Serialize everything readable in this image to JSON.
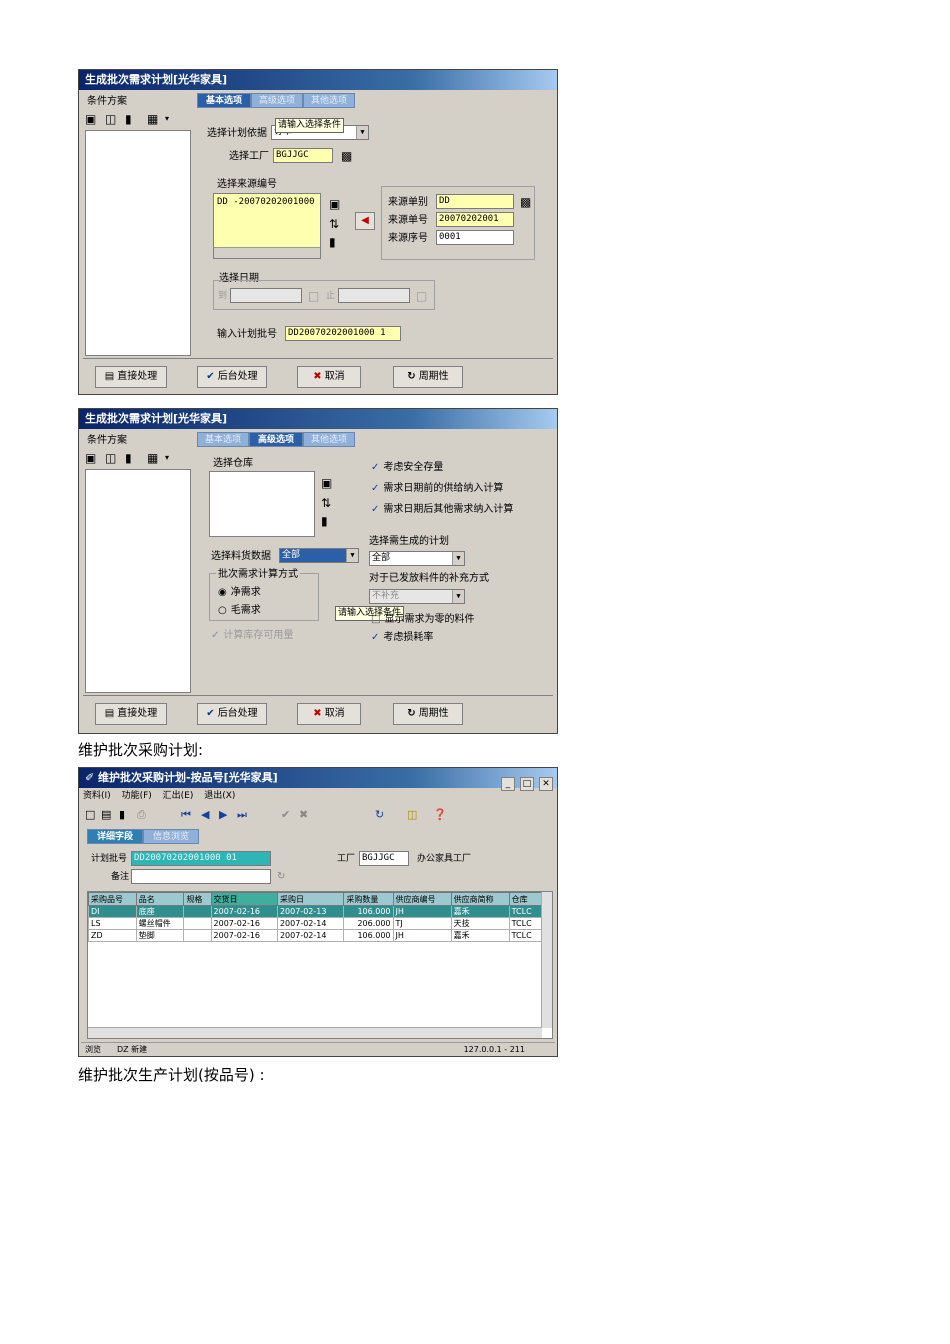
{
  "win1": {
    "title": "生成批次需求计划[光华家具]",
    "scheme_label": "条件方案",
    "tabs": [
      "基本选项",
      "高级选项",
      "其他选项"
    ],
    "plan_name_label": "选择计划依据",
    "plan_name_value": "订单",
    "tooltip": "请输入选择条件",
    "factory_label": "选择工厂",
    "factory_value": "BGJJGC",
    "source_no_label": "选择来源编号",
    "source_list_item": "DD  -20070202001000",
    "source_type_label": "来源单别",
    "source_type_value": "DD",
    "source_no2_label": "来源单号",
    "source_no2_value": "20070202001",
    "source_seq_label": "来源序号",
    "source_seq_value": "0001",
    "date_label": "选择日期",
    "date_from": "到",
    "date_to": "止",
    "batch_label": "输入计划批号",
    "batch_value": "DD20070202001000 1",
    "buttons": [
      "直接处理",
      "后台处理",
      "取消",
      "周期性"
    ]
  },
  "win2": {
    "title": "生成批次需求计划[光华家具]",
    "scheme_label": "条件方案",
    "tabs": [
      "基本选项",
      "高级选项",
      "其他选项"
    ],
    "warehouse_label": "选择仓库",
    "check1": "考虑安全存量",
    "check2": "需求日期前的供给纳入计算",
    "check3": "需求日期后其他需求纳入计算",
    "gen_plan_label": "选择需生成的计划",
    "gen_plan_value": "全部",
    "material_label": "选择料货数据",
    "material_value": "全部",
    "method_label": "批次需求计算方式",
    "radio1": "净需求",
    "radio2": "毛需求",
    "supplement_label": "对于已发放料件的补充方式",
    "supplement_value": "不补充",
    "tooltip": "请输入选择条件",
    "check4": "显示需求为零的料件",
    "check5": "考虑损耗率",
    "check6": "计算库存可用量",
    "buttons": [
      "直接处理",
      "后台处理",
      "取消",
      "周期性"
    ]
  },
  "caption1": "维护批次采购计划:",
  "win3": {
    "title": "维护批次采购计划-按品号[光华家具]",
    "menu": [
      "资料(I)",
      "功能(F)",
      "汇出(E)",
      "退出(X)"
    ],
    "tabs": [
      "详细字段",
      "信息浏览"
    ],
    "batch_label": "计划批号",
    "batch_value": "DD20070202001000 01",
    "remark_label": "备注",
    "factory_label": "工厂",
    "factory_value": "BGJJGC",
    "factory_name": "办公家具工厂",
    "columns": [
      "采购品号",
      "品名",
      "规格",
      "交货日",
      "采购日",
      "采购数量",
      "供应商编号",
      "供应商简称",
      "仓库"
    ],
    "rows": [
      [
        "DI",
        "底座",
        "",
        "2007-02-16",
        "2007-02-13",
        "106.000",
        "JH",
        "嘉禾",
        "TCLC"
      ],
      [
        "LS",
        "螺丝帽件",
        "",
        "2007-02-16",
        "2007-02-14",
        "206.000",
        "TJ",
        "天技",
        "TCLC"
      ],
      [
        "ZD",
        "垫脚",
        "",
        "2007-02-16",
        "2007-02-14",
        "106.000",
        "JH",
        "嘉禾",
        "TCLC"
      ]
    ],
    "status": [
      "浏览",
      "DZ 新建",
      "127.0.0.1 - 211"
    ]
  },
  "caption2": "维护批次生产计划(按品号) :"
}
